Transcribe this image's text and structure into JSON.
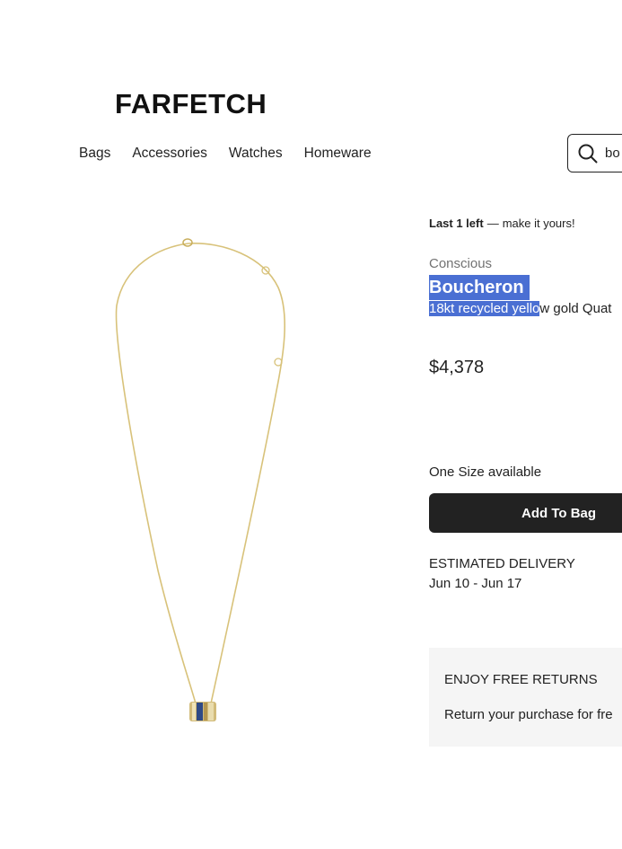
{
  "header": {
    "logo": "FARFETCH",
    "nav": [
      {
        "label": "Bags"
      },
      {
        "label": "Accessories"
      },
      {
        "label": "Watches"
      },
      {
        "label": "Homeware"
      }
    ],
    "search": {
      "value": "bo",
      "icon": "search-icon"
    }
  },
  "product": {
    "stock_bold": "Last 1 left",
    "stock_dash": "—",
    "stock_rest": "make it yours!",
    "tag": "Conscious",
    "brand": "Boucheron",
    "title_selected": "18kt recycled yello",
    "title_rest": "w gold Quat",
    "price": "$4,378",
    "size_text": "One Size available",
    "add_to_bag": "Add To Bag",
    "delivery_heading": "ESTIMATED DELIVERY",
    "delivery_dates": "Jun 10 - Jun 17"
  },
  "returns": {
    "heading": "ENJOY FREE RETURNS",
    "text": "Return your purchase for fre"
  },
  "colors": {
    "selection": "#4a6fd3",
    "button": "#222222",
    "returns_bg": "#f5f5f5",
    "gold_chain": "#d8c27a",
    "pendant_blue": "#2f4a86"
  }
}
